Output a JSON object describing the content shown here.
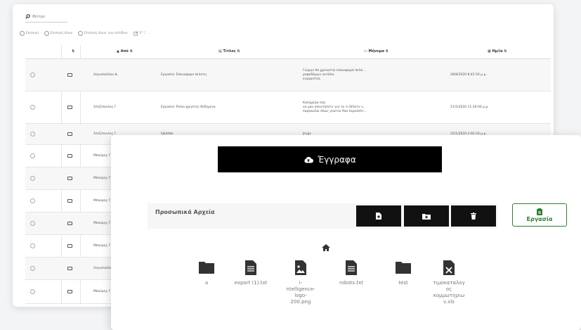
{
  "list": {
    "filter_label": "Φίλτρο",
    "toolbar": {
      "select": "Επιλογή",
      "select_all": "Επιλογή όλων",
      "select_all_pages": "Επιλογή όλων των σελίδων",
      "more": "∇ ⊤ . . ."
    },
    "headers": {
      "sort": "⇅",
      "from": "Από ⇅",
      "title": "Τίτλος ⇅",
      "message": "Μήνυμα ⇅",
      "date": "Ημ/ία ⇅"
    },
    "rows": [
      {
        "from": "Λαγιοπούλου Δ.",
        "title": "Εργασία: Επαναφορα πελατη",
        "message": [
          "Γιώργο θα χρειαστώ επαναφορά πελά...",
          "ροφοδόμων νατάλα.",
          "ευχαριστώ,"
        ],
        "date": "28/8/2020 8:42:56 μ.μ."
      },
      {
        "from": "Αλεξίπουλος Γ.",
        "title": "Εργασία: Ρολοι-χρηστες-δεδομενα",
        "message": [
          "Καλημέρα σας",
          "να μου απαντήσετε για το τι θέλετε ν...",
          "παρακαλώ όπως γίνεται δοο περισσότ..."
        ],
        "date": "21/5/2020 11:30:00 μ.μ."
      },
      {
        "from": "Αλεξίπουλος Γ.",
        "title": "hjkkhbk",
        "message": [
          "jhvjjv"
        ],
        "date": "22/1/2020 2:02:24 μ.μ."
      },
      {
        "from": "Μπούρης Γ.",
        "title": "",
        "message": [],
        "date": ""
      },
      {
        "from": "Μπούρης Γ.",
        "title": "",
        "message": [],
        "date": ""
      },
      {
        "from": "Μπούρης Γ.",
        "title": "",
        "message": [],
        "date": ""
      },
      {
        "from": "Μπούρης Γ.",
        "title": "",
        "message": [],
        "date": ""
      },
      {
        "from": "Μπούρης Γ.",
        "title": "",
        "message": [],
        "date": ""
      },
      {
        "from": "Λαγιοπούλου Δ.",
        "title": "",
        "message": [],
        "date": ""
      },
      {
        "from": "Μπούρης Γ.",
        "title": "",
        "message": [],
        "date": ""
      }
    ]
  },
  "docs": {
    "header": "Έγγραφα",
    "folder_title": "Προσωπικά Αρχεία",
    "work_button": "Εργασία",
    "files": [
      {
        "name": "a",
        "kind": "folder"
      },
      {
        "name": "export (1).txt",
        "kind": "doc"
      },
      {
        "name": "i-\nntelligence-\nlogo-\n200.png",
        "kind": "image"
      },
      {
        "name": "robots.txt",
        "kind": "doc"
      },
      {
        "name": "test",
        "kind": "folder"
      },
      {
        "name": "τιμοκαταλογ\nος\nκομμωτηριω\nν.xls",
        "kind": "excel"
      }
    ]
  }
}
